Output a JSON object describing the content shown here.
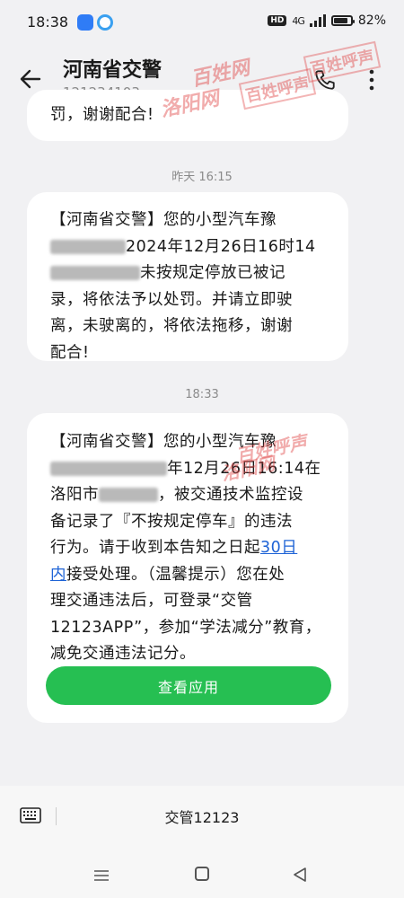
{
  "status_bar": {
    "time": "18:38",
    "hd_badge": "HD",
    "network": "4G",
    "battery_level": 0.82,
    "battery_text": "82%"
  },
  "header": {
    "contact_name": "河南省交警",
    "contact_number": "121234103"
  },
  "messages": [
    {
      "text": "罚，谢谢配合!"
    },
    {
      "time": "昨天 16:15",
      "line1": "【河南省交警】您的小型汽车豫",
      "line2_after_redaction": "2024年12月26日16时14",
      "line3_after_redaction": "未按规定停放已被记",
      "line4": "录，将依法予以处罚。并请立即驶",
      "line5": "离，未驶离的，将依法拖移，谢谢",
      "line6": "配合!"
    },
    {
      "time": "18:33",
      "line1": "【河南省交警】您的小型汽车豫",
      "line2_after_redaction": "年12月26日16:14在",
      "line3_before_redaction": "洛阳市",
      "line3_after_redaction": "，被交通技术监控设",
      "line4": "备记录了『不按规定停车』的违法",
      "line5_before_link": "行为。请于收到本告知之日起",
      "link_text_part1": "30日",
      "link_text_part2": "内",
      "line6_after_link": "接受处理。（温馨提示）您在处",
      "line7": "理交通违法后，可登录“交管",
      "line8": "12123APP”，参加“学法减分”教育，",
      "line9": "减免交通违法记分。",
      "action_button": "查看应用"
    }
  ],
  "input_bar": {
    "text": "交管12123"
  },
  "watermarks": {
    "brand1": "百姓呼声",
    "brand2": "洛阳网",
    "color": "#e14646"
  },
  "colors": {
    "accent_green": "#26bf52",
    "link_blue": "#1e63d6"
  }
}
